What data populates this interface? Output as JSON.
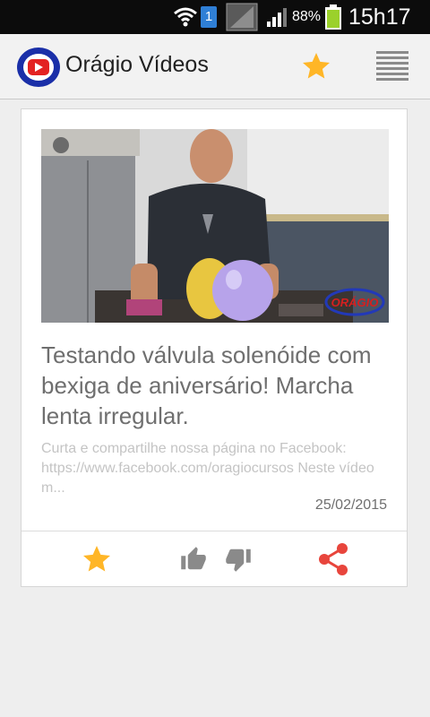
{
  "status_bar": {
    "notification_badge": "1",
    "battery_percent": "88%",
    "time": "15h17"
  },
  "app_bar": {
    "title": "Orágio Vídeos",
    "icons": [
      "app-logo-icon",
      "star-icon",
      "menu-icon"
    ]
  },
  "video_card": {
    "thumbnail_logo_text": "ORÁGIO",
    "title": "Testando válvula solenóide com bexiga de aniversário! Marcha lenta irregular.",
    "description": "Curta e compartilhe nossa página no Facebook: https://www.facebook.com/oragiocursos Neste vídeo m...",
    "date": "25/02/2015",
    "actions": [
      "favorite-star-icon",
      "thumbs-up-icon",
      "thumbs-down-icon",
      "share-icon"
    ]
  },
  "colors": {
    "star": "#ffb627",
    "share": "#e8453c",
    "logo_blue": "#1a2fa8",
    "logo_red": "#e32222",
    "text_gray": "#6f6f6f",
    "desc_gray": "#c4c4c4"
  }
}
